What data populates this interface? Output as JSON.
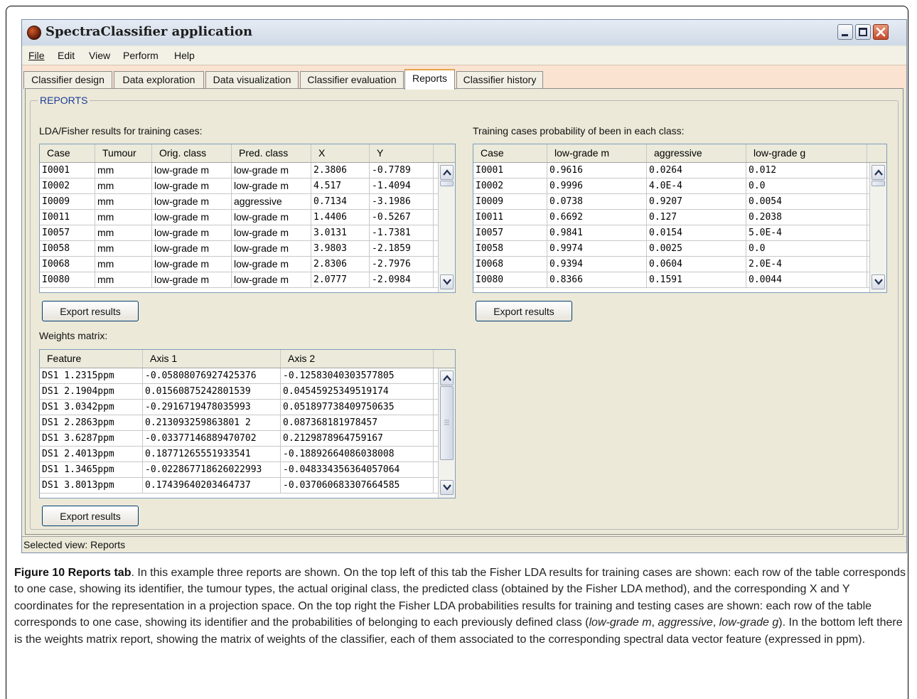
{
  "window": {
    "title": "SpectraClassifier application"
  },
  "menu": [
    "File",
    "Edit",
    "View",
    "Perform",
    "Help"
  ],
  "tabs": [
    "Classifier design",
    "Data exploration",
    "Data visualization",
    "Classifier evaluation",
    "Reports",
    "Classifier history"
  ],
  "active_tab": "Reports",
  "group_title": "REPORTS",
  "lda": {
    "label": "LDA/Fisher results for training cases:",
    "columns": [
      "Case",
      "Tumour",
      "Orig. class",
      "Pred. class",
      "X",
      "Y"
    ],
    "rows": [
      [
        "I0001",
        "mm",
        "low-grade m",
        "low-grade m",
        "2.3806",
        "-0.7789"
      ],
      [
        "I0002",
        "mm",
        "low-grade m",
        "low-grade m",
        "4.517",
        "-1.4094"
      ],
      [
        "I0009",
        "mm",
        "low-grade m",
        "aggressive",
        "0.7134",
        "-3.1986"
      ],
      [
        "I0011",
        "mm",
        "low-grade m",
        "low-grade m",
        "1.4406",
        "-0.5267"
      ],
      [
        "I0057",
        "mm",
        "low-grade m",
        "low-grade m",
        "3.0131",
        "-1.7381"
      ],
      [
        "I0058",
        "mm",
        "low-grade m",
        "low-grade m",
        "3.9803",
        "-2.1859"
      ],
      [
        "I0068",
        "mm",
        "low-grade m",
        "low-grade m",
        "2.8306",
        "-2.7976"
      ],
      [
        "I0080",
        "mm",
        "low-grade m",
        "low-grade m",
        "2.0777",
        "-2.0984"
      ]
    ],
    "export_label": "Export results"
  },
  "prob": {
    "label": "Training cases probability of been in each class:",
    "columns": [
      "Case",
      "low-grade m",
      "aggressive",
      "low-grade g"
    ],
    "rows": [
      [
        "I0001",
        "0.9616",
        "0.0264",
        "0.012"
      ],
      [
        "I0002",
        "0.9996",
        "4.0E-4",
        "0.0"
      ],
      [
        "I0009",
        "0.0738",
        "0.9207",
        "0.0054"
      ],
      [
        "I0011",
        "0.6692",
        "0.127",
        "0.2038"
      ],
      [
        "I0057",
        "0.9841",
        "0.0154",
        "5.0E-4"
      ],
      [
        "I0058",
        "0.9974",
        "0.0025",
        "0.0"
      ],
      [
        "I0068",
        "0.9394",
        "0.0604",
        "2.0E-4"
      ],
      [
        "I0080",
        "0.8366",
        "0.1591",
        "0.0044"
      ]
    ],
    "export_label": "Export results"
  },
  "weights": {
    "label": "Weights matrix:",
    "columns": [
      "Feature",
      "Axis 1",
      "Axis 2"
    ],
    "rows": [
      [
        "DS1 1.2315ppm",
        "-0.05808076927425376",
        "-0.12583040303577805"
      ],
      [
        "DS1 2.1904ppm",
        "0.01560875242801539",
        "0.04545925349519174"
      ],
      [
        "DS1 3.0342ppm",
        "-0.2916719478035993",
        "0.051897738409750635"
      ],
      [
        "DS1 2.2863ppm",
        "0.213093259863801 2",
        "0.087368181978457"
      ],
      [
        "DS1 3.6287ppm",
        "-0.03377146889470702",
        "0.2129878964759167"
      ],
      [
        "DS1 2.4013ppm",
        "0.18771265551933541",
        "-0.18892664086038008"
      ],
      [
        "DS1 1.3465ppm",
        "-0.022867718626022993",
        "-0.048334356364057064"
      ],
      [
        "DS1 3.8013ppm",
        "0.17439640203464737",
        "-0.037060683307664585"
      ]
    ],
    "export_label": "Export results"
  },
  "status": "Selected view: Reports",
  "caption": {
    "bold": "Figure 10 Reports tab",
    "text_1": ". In this example three reports are shown. On the top left of this tab the Fisher LDA results for training cases are shown: each row of the table corresponds to one case, showing its identifier, the tumour types, the actual original class, the predicted class (obtained by the Fisher LDA method), and the corresponding X and Y coordinates for the representation in a projection space. On the top right the Fisher LDA probabilities results for training and testing cases are shown: each row of the table corresponds to one case, showing its identifier and the probabilities of belonging to each previously defined class (",
    "italic_1": "low-grade m",
    "sep_1": ", ",
    "italic_2": "aggressive",
    "sep_2": ", ",
    "italic_3": "low-grade g",
    "text_2": "). In the bottom left there is the weights matrix report, showing the matrix of weights of the classifier, each of them associated to the corresponding spectral data vector feature (expressed in ppm)."
  }
}
